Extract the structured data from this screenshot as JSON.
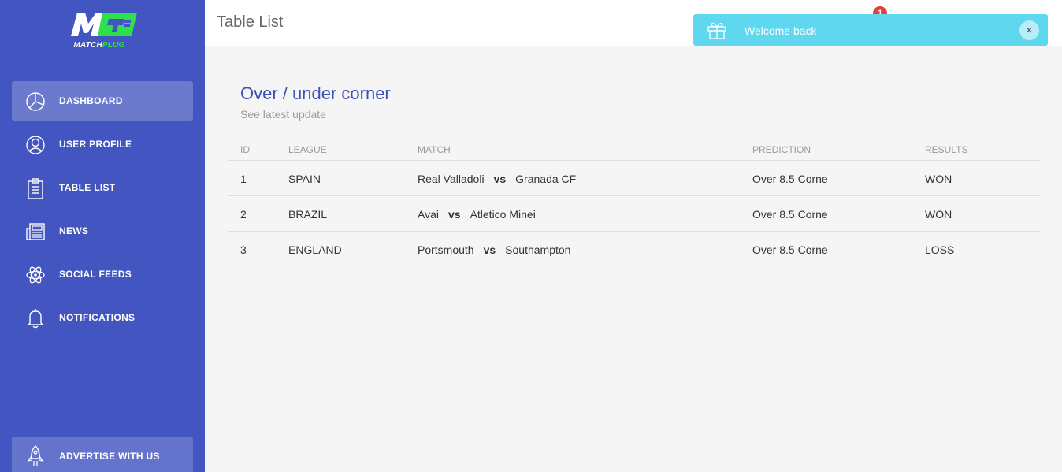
{
  "brand": {
    "logo_text_a": "MATCH",
    "logo_text_b": "PLUG"
  },
  "sidebar": {
    "items": [
      {
        "label": "DASHBOARD",
        "icon": "pie-chart-icon",
        "active": true
      },
      {
        "label": "USER PROFILE",
        "icon": "user-icon",
        "active": false
      },
      {
        "label": "TABLE LIST",
        "icon": "clipboard-icon",
        "active": false
      },
      {
        "label": "NEWS",
        "icon": "newspaper-icon",
        "active": false
      },
      {
        "label": "SOCIAL FEEDS",
        "icon": "atom-icon",
        "active": false
      },
      {
        "label": "NOTIFICATIONS",
        "icon": "bell-icon",
        "active": false
      }
    ],
    "advertise": {
      "label": "ADVERTISE WITH US",
      "icon": "rocket-icon"
    },
    "bg_color": "#4355c0"
  },
  "header": {
    "title": "Table List",
    "notification_count": "1"
  },
  "toast": {
    "message": "Welcome back",
    "close": "×",
    "icon": "gift-icon",
    "color": "#5fd7ef"
  },
  "card": {
    "title": "Over / under corner",
    "subtitle": "See latest update",
    "columns": [
      "ID",
      "LEAGUE",
      "MATCH",
      "PREDICTION",
      "RESULTS"
    ],
    "vs_label": "vs",
    "rows": [
      {
        "id": "1",
        "league": "SPAIN",
        "home": "Real Valladoli",
        "away": "Granada CF",
        "prediction": "Over 8.5 Corne",
        "result": "WON"
      },
      {
        "id": "2",
        "league": "BRAZIL",
        "home": "Avai",
        "away": "Atletico Minei",
        "prediction": "Over 8.5 Corne",
        "result": "WON"
      },
      {
        "id": "3",
        "league": "ENGLAND",
        "home": "Portsmouth",
        "away": "Southampton",
        "prediction": "Over 8.5 Corne",
        "result": "LOSS"
      }
    ]
  }
}
